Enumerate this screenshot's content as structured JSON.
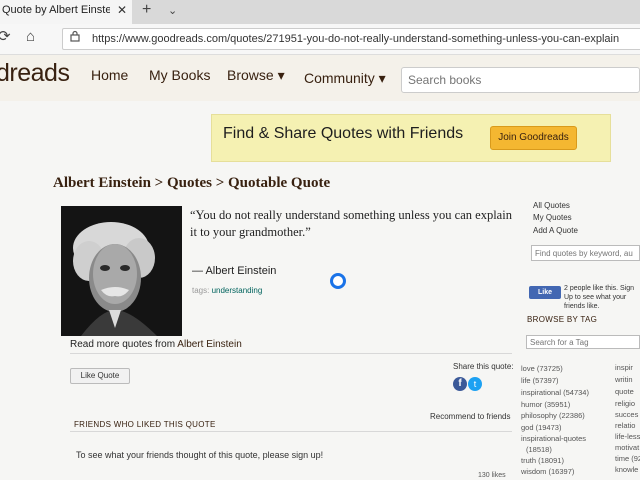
{
  "browser": {
    "tab_title": "Quote by Albert Einstein",
    "tab_close": "✕",
    "new_tab": "+",
    "tab_list": "⌄",
    "url": "https://www.goodreads.com/quotes/271951-you-do-not-really-understand-something-unless-you-can-explain"
  },
  "header": {
    "logo": "dreads",
    "nav": [
      "Home",
      "My Books",
      "Browse ▾",
      "Community ▾"
    ],
    "search_placeholder": "Search books"
  },
  "banner": {
    "text": "Find & Share Quotes with Friends",
    "button": "Join Goodreads"
  },
  "breadcrumb": "Albert Einstein > Quotes > Quotable Quote",
  "quote": {
    "text": "“You do not really understand something unless you can explain it to your grandmother.”",
    "author": "― Albert Einstein",
    "tags_label": "tags:",
    "tag": "understanding",
    "read_more_prefix": "Read more quotes from",
    "read_more_author": "Albert Einstein"
  },
  "actions": {
    "like": "Like Quote",
    "share_label": "Share this quote:",
    "recommend": "Recommend to friends",
    "friends_heading": "FRIENDS WHO LIKED THIS QUOTE",
    "signup_text": "To see what your friends thought of this quote, please sign up!",
    "likes_count": "130 likes"
  },
  "sidebar": {
    "links": [
      "All Quotes",
      "My Quotes",
      "Add A Quote"
    ],
    "search_placeholder": "Find quotes by keyword, au",
    "fb_like": "Like",
    "fb_text": "2 people like this. Sign Up to see what your friends like.",
    "browse_heading": "BROWSE BY TAG",
    "tag_search_placeholder": "Search for a Tag",
    "tags_col1": [
      "love (73725)",
      "life (57397)",
      "inspirational (54734)",
      "humor (35951)",
      "philosophy (22386)",
      "god (19473)",
      "inspirational-quotes",
      "(18518)",
      "truth (18091)",
      "wisdom (16397)"
    ],
    "tags_col2": [
      "inspir",
      "writin",
      "quote",
      "religio",
      "succes",
      "relatio",
      "life-less",
      "motivat",
      "time (92",
      "knowle"
    ]
  },
  "colors": {
    "brand_brown": "#382110",
    "banner_yellow": "#f5f1b2",
    "join_button": "#f4b731",
    "link_teal": "#00635d",
    "facebook": "#3b5998",
    "twitter": "#1da1f2"
  }
}
